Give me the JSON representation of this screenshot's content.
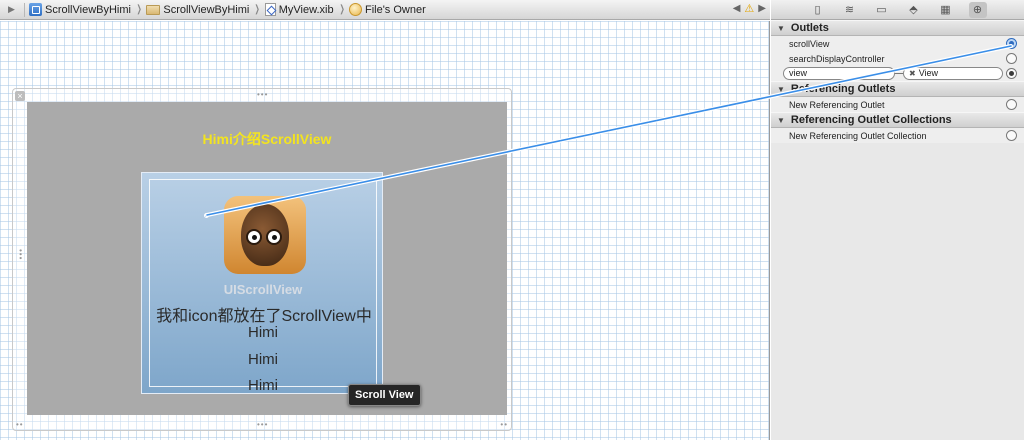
{
  "jumpbar": {
    "crumbs": [
      {
        "label": "ScrollViewByHimi",
        "icon": "project-icon"
      },
      {
        "label": "ScrollViewByHimi",
        "icon": "folder-icon"
      },
      {
        "label": "MyView.xib",
        "icon": "xib-file-icon"
      },
      {
        "label": "File's Owner",
        "icon": "files-owner-icon"
      }
    ]
  },
  "canvas": {
    "title_label": "Himi介绍ScrollView",
    "scroll_view_label": "UIScrollView",
    "content_text": "我和icon都放在了ScrollView中",
    "himi_lines": [
      "Himi",
      "Himi",
      "Himi"
    ],
    "tooltip": "Scroll View"
  },
  "inspector": {
    "outlets_header": "Outlets",
    "outlets": [
      {
        "name": "scrollView",
        "connected": true
      },
      {
        "name": "searchDisplayController",
        "connected": false
      }
    ],
    "view_connection": {
      "from": "view",
      "to": "View"
    },
    "ref_outlets_header": "Referencing Outlets",
    "ref_outlets_new": "New Referencing Outlet",
    "ref_collections_header": "Referencing Outlet Collections",
    "ref_collections_new": "New Referencing Outlet Collection"
  },
  "colors": {
    "title_yellow": "#f3e41f",
    "connection_blue": "#3a8ee8",
    "scroll_bg": "#7ea6ca"
  }
}
